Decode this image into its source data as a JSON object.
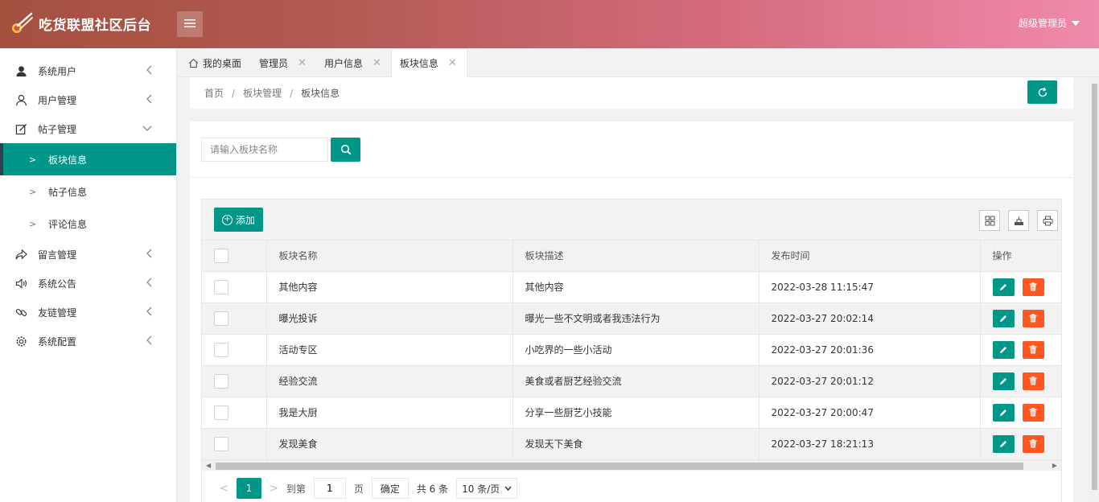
{
  "app": {
    "title": "吃货联盟社区后台"
  },
  "header": {
    "user": "超级管理员"
  },
  "sidebar": {
    "items": [
      {
        "label": "系统用户",
        "icon": "user-filled-icon"
      },
      {
        "label": "用户管理",
        "icon": "user-outline-icon"
      },
      {
        "label": "帖子管理",
        "icon": "edit-icon"
      },
      {
        "label": "留言管理",
        "icon": "share-icon"
      },
      {
        "label": "系统公告",
        "icon": "speaker-icon"
      },
      {
        "label": "友链管理",
        "icon": "link-icon"
      },
      {
        "label": "系统配置",
        "icon": "gear-icon"
      }
    ],
    "sub": [
      "板块信息",
      "帖子信息",
      "评论信息"
    ]
  },
  "tabs": [
    "我的桌面",
    "管理员",
    "用户信息",
    "板块信息"
  ],
  "breadcrumb": [
    "首页",
    "板块管理",
    "板块信息"
  ],
  "search": {
    "placeholder": "请输入板块名称"
  },
  "toolbar": {
    "add_label": "添加"
  },
  "table": {
    "headers": [
      "板块名称",
      "板块描述",
      "发布时间",
      "操作"
    ],
    "rows": [
      [
        "其他内容",
        "其他内容",
        "2022-03-28 11:15:47"
      ],
      [
        "曝光投诉",
        "曝光一些不文明或者我违法行为",
        "2022-03-27 20:02:14"
      ],
      [
        "活动专区",
        "小吃界的一些小活动",
        "2022-03-27 20:01:36"
      ],
      [
        "经验交流",
        "美食或者厨艺经验交流",
        "2022-03-27 20:01:12"
      ],
      [
        "我是大厨",
        "分享一些厨艺小技能",
        "2022-03-27 20:00:47"
      ],
      [
        "发现美食",
        "发现天下美食",
        "2022-03-27 18:21:13"
      ]
    ]
  },
  "pager": {
    "current": "1",
    "goto_label": "到第",
    "goto_value": "1",
    "page_unit": "页",
    "ok_label": "确定",
    "total": "共 6 条",
    "size": "10 条/页"
  },
  "colors": {
    "primary": "#009688",
    "danger": "#ff5722"
  }
}
